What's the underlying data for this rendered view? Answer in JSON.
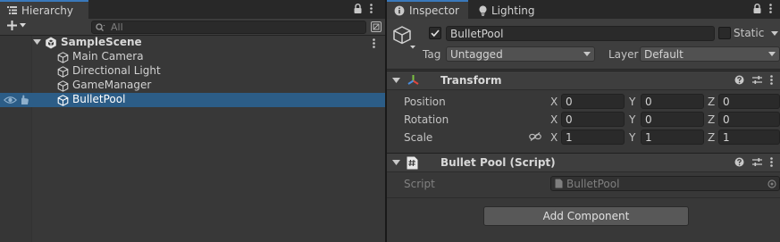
{
  "hierarchy": {
    "tab_label": "Hierarchy",
    "add_button_label": "+",
    "search_placeholder": "All",
    "scene_name": "SampleScene",
    "items": [
      {
        "label": "Main Camera"
      },
      {
        "label": "Directional Light"
      },
      {
        "label": "GameManager"
      },
      {
        "label": "BulletPool"
      }
    ],
    "selected_item": "BulletPool"
  },
  "inspector": {
    "tabs": [
      {
        "label": "Inspector"
      },
      {
        "label": "Lighting"
      }
    ],
    "object": {
      "name": "BulletPool",
      "active": true,
      "static_label": "Static",
      "tag_label": "Tag",
      "tag_value": "Untagged",
      "layer_label": "Layer",
      "layer_value": "Default"
    },
    "transform": {
      "title": "Transform",
      "position": {
        "label": "Position",
        "x": "0",
        "y": "0",
        "z": "0"
      },
      "rotation": {
        "label": "Rotation",
        "x": "0",
        "y": "0",
        "z": "0"
      },
      "scale": {
        "label": "Scale",
        "x": "1",
        "y": "1",
        "z": "1"
      },
      "axis_x": "X",
      "axis_y": "Y",
      "axis_z": "Z"
    },
    "script_component": {
      "title": "Bullet Pool (Script)",
      "script_label": "Script",
      "script_value": "BulletPool"
    },
    "add_component_label": "Add Component"
  },
  "colors": {
    "panel_bg": "#383838",
    "selection": "#2c5d87",
    "tab_accent": "#3a79bb",
    "field_bg": "#2a2a2a"
  }
}
